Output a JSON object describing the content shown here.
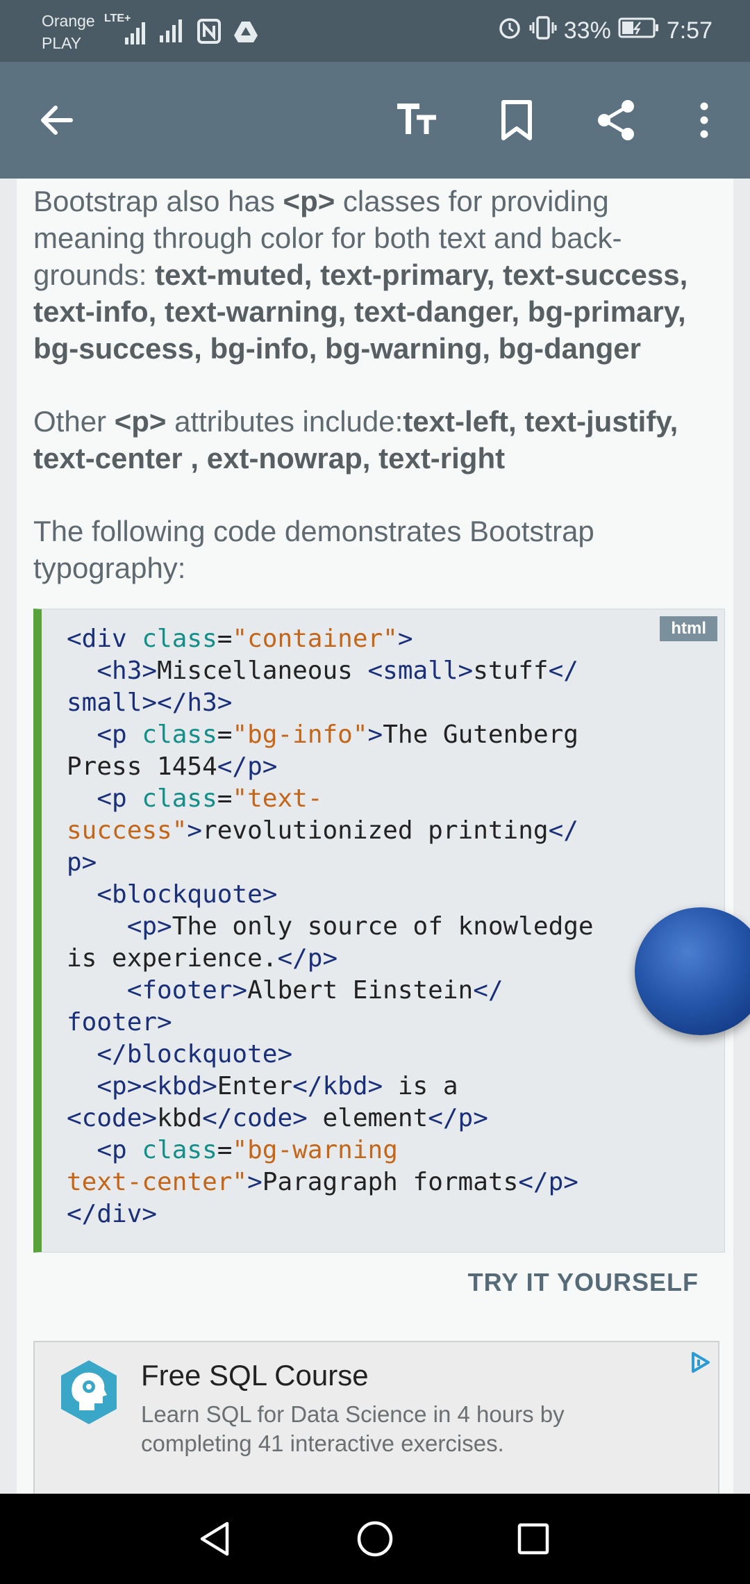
{
  "status_bar": {
    "carrier_line1": "Orange",
    "carrier_line2": "PLAY",
    "network": "LTE+",
    "battery_percent": "33%",
    "time": "7:57"
  },
  "toolbar": {
    "icons": [
      "back-arrow-icon",
      "text-size-icon",
      "bookmark-icon",
      "share-icon",
      "more-vertical-icon"
    ]
  },
  "article": {
    "para1": {
      "p1": "Bootstrap also has ",
      "b1": "<p>",
      "p2": " classes for providing meaning through color for both text and back-grounds: ",
      "b2": "text-muted, text-primary, text-success, text-info, text-warning, text-danger, bg-primary, bg-success, bg-info, bg-warning, bg-danger"
    },
    "para2": {
      "p1": "Other ",
      "b1": "<p>",
      "p2": " attributes include:",
      "b2": "text-left, text-justify, text-center , ext-nowrap, text-right"
    },
    "para3": "The following code demonstrates Bootstrap typography:"
  },
  "code_block": {
    "language": "html",
    "lines": [
      [
        [
          "t",
          "<div "
        ],
        [
          "a",
          "class"
        ],
        [
          "p",
          "="
        ],
        [
          "s",
          "\"container\""
        ],
        [
          "t",
          ">"
        ]
      ],
      [
        [
          "p",
          "  "
        ],
        [
          "t",
          "<h3>"
        ],
        [
          "p",
          "Miscellaneous "
        ],
        [
          "t",
          "<small>"
        ],
        [
          "p",
          "stuff"
        ],
        [
          "t",
          "</"
        ]
      ],
      [
        [
          "t",
          "small></h3>"
        ]
      ],
      [
        [
          "p",
          "  "
        ],
        [
          "t",
          "<p "
        ],
        [
          "a",
          "class"
        ],
        [
          "p",
          "="
        ],
        [
          "s",
          "\"bg-info\""
        ],
        [
          "t",
          ">"
        ],
        [
          "p",
          "The Gutenberg"
        ]
      ],
      [
        [
          "p",
          "Press 1454"
        ],
        [
          "t",
          "</p>"
        ]
      ],
      [
        [
          "p",
          "  "
        ],
        [
          "t",
          "<p "
        ],
        [
          "a",
          "class"
        ],
        [
          "p",
          "="
        ],
        [
          "s",
          "\"text-"
        ]
      ],
      [
        [
          "s",
          "success\""
        ],
        [
          "t",
          ">"
        ],
        [
          "p",
          "revolutionized printing"
        ],
        [
          "t",
          "</"
        ]
      ],
      [
        [
          "t",
          "p>"
        ]
      ],
      [
        [
          "p",
          "  "
        ],
        [
          "t",
          "<blockquote>"
        ]
      ],
      [
        [
          "p",
          "    "
        ],
        [
          "t",
          "<p>"
        ],
        [
          "p",
          "The only source of knowledge"
        ]
      ],
      [
        [
          "p",
          "is experience."
        ],
        [
          "t",
          "</p>"
        ]
      ],
      [
        [
          "p",
          "    "
        ],
        [
          "t",
          "<footer>"
        ],
        [
          "p",
          "Albert Einstein"
        ],
        [
          "t",
          "</"
        ]
      ],
      [
        [
          "t",
          "footer>"
        ]
      ],
      [
        [
          "p",
          "  "
        ],
        [
          "t",
          "</blockquote>"
        ]
      ],
      [
        [
          "p",
          "  "
        ],
        [
          "t",
          "<p><kbd>"
        ],
        [
          "p",
          "Enter"
        ],
        [
          "t",
          "</kbd>"
        ],
        [
          "p",
          " is a"
        ]
      ],
      [
        [
          "t",
          "<code>"
        ],
        [
          "p",
          "kbd"
        ],
        [
          "t",
          "</code>"
        ],
        [
          "p",
          " element"
        ],
        [
          "t",
          "</p>"
        ]
      ],
      [
        [
          "p",
          "  "
        ],
        [
          "t",
          "<p "
        ],
        [
          "a",
          "class"
        ],
        [
          "p",
          "="
        ],
        [
          "s",
          "\"bg-warning"
        ]
      ],
      [
        [
          "s",
          "text-center\""
        ],
        [
          "t",
          ">"
        ],
        [
          "p",
          "Paragraph formats"
        ],
        [
          "t",
          "</p>"
        ]
      ],
      [
        [
          "t",
          "</div>"
        ]
      ]
    ]
  },
  "try_button": "TRY IT YOURSELF",
  "ad": {
    "title": "Free SQL Course",
    "description": "Learn SQL for Data Science in 4 hours by completing 41 interactive exercises.",
    "icon": "head-gear-icon",
    "badge_icon": "ad-choices-icon"
  },
  "navigation_bar": {
    "icons": [
      "nav-back-icon",
      "nav-home-icon",
      "nav-recents-icon"
    ]
  },
  "colors": {
    "status_bar": "#4a5b65",
    "toolbar": "#5c7280",
    "code_accent": "#58a23a",
    "tag": "#1a2f7a",
    "attr": "#138e88",
    "string": "#c4661a"
  }
}
